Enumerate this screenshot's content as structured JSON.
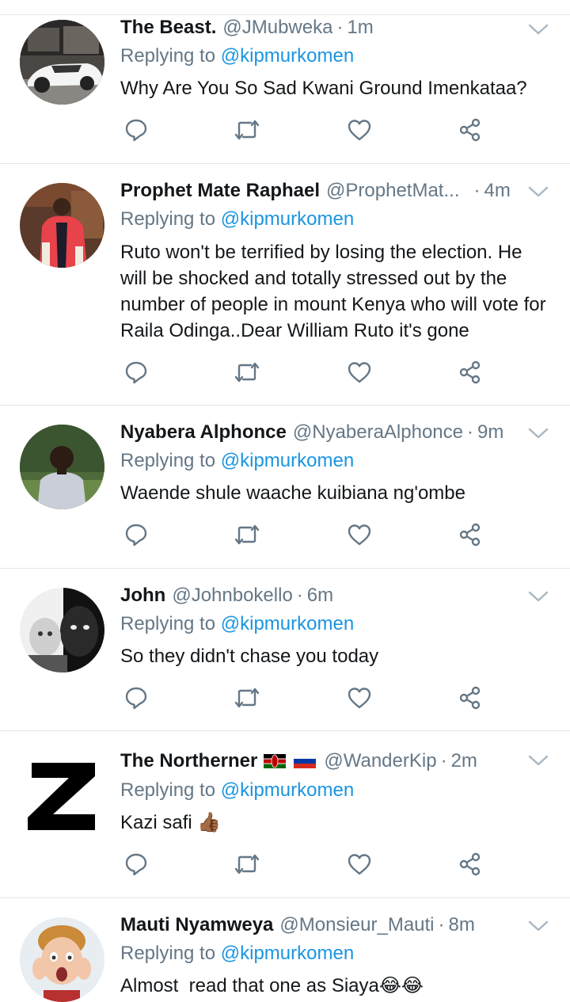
{
  "tweets": [
    {
      "name": "The Beast.",
      "handle": "@JMubweka",
      "time": "1m",
      "replying_prefix": "Replying to",
      "replying_to": "@kipmurkomen",
      "text": "Why Are You So Sad Kwani Ground Imenkataa?",
      "flags": []
    },
    {
      "name": "Prophet Mate Raphael",
      "handle": "@ProphetMat...",
      "time": "4m",
      "replying_prefix": "Replying to",
      "replying_to": "@kipmurkomen",
      "text": "Ruto won't be terrified by losing the election. He will be shocked and totally stressed out by the number of people in mount Kenya who will vote for Raila Odinga..Dear William Ruto it's gone",
      "flags": []
    },
    {
      "name": "Nyabera Alphonce",
      "handle": "@NyaberaAlphonce",
      "time": "9m",
      "replying_prefix": "Replying to",
      "replying_to": "@kipmurkomen",
      "text": "Waende shule waache kuibiana ng'ombe",
      "flags": []
    },
    {
      "name": "John",
      "handle": "@Johnbokello",
      "time": "6m",
      "replying_prefix": "Replying to",
      "replying_to": "@kipmurkomen",
      "text": "So they didn't chase you today",
      "flags": []
    },
    {
      "name": "The Northerner",
      "handle": "@WanderKip",
      "time": "2m",
      "replying_prefix": "Replying to",
      "replying_to": "@kipmurkomen",
      "text": "Kazi safi 👍🏾",
      "flags": [
        "kenya-flag",
        "russia-flag"
      ]
    },
    {
      "name": "Mauti Nyamweya",
      "handle": "@Monsieur_Mauti",
      "time": "8m",
      "replying_prefix": "Replying to",
      "replying_to": "@kipmurkomen",
      "text": "Almost  read that one as Siaya😂😂",
      "flags": []
    }
  ],
  "separator": "·",
  "icons": {
    "reply": "reply-icon",
    "retweet": "retweet-icon",
    "like": "like-icon",
    "share": "share-icon",
    "menu": "chevron-down-icon"
  },
  "colors": {
    "name": "#14171a",
    "meta": "#657786",
    "mention": "#1b95e0",
    "icon": "#657786",
    "divider": "#e1e8ed"
  }
}
